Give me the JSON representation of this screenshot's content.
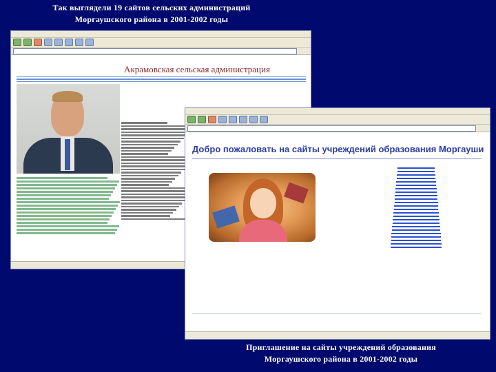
{
  "captions": {
    "top_line1": "Так выглядели 19 сайтов сельских администраций",
    "top_line2": "Моргаушского района в 2001-2002 годы",
    "bottom_line1": "Приглашение на сайты учреждений образования",
    "bottom_line2": "Моргаушского района в 2001-2002 годы"
  },
  "site1": {
    "title": "Акрамовская сельская администрация"
  },
  "site2": {
    "title": "Добро пожаловать на сайты учреждений образования Моргауши"
  },
  "colors": {
    "background": "#000a6e",
    "caption": "#ffffff",
    "site1_title": "#8a2a2a",
    "site2_title": "#2a3ca8"
  }
}
